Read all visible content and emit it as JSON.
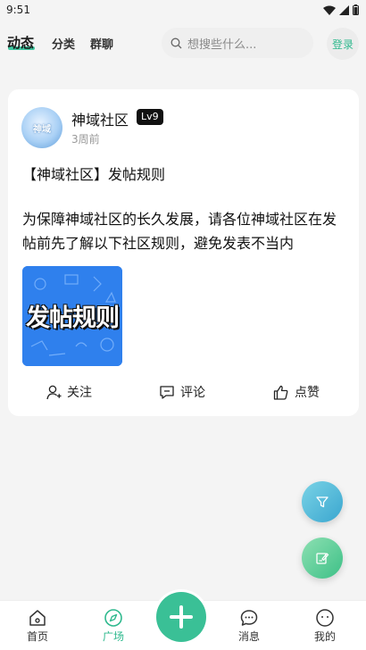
{
  "status_bar": {
    "time": "9:51"
  },
  "header": {
    "tabs": [
      {
        "label": "动态"
      },
      {
        "label": "分类"
      },
      {
        "label": "群聊"
      }
    ],
    "search_placeholder": "想搜些什么...",
    "login_label": "登录"
  },
  "post": {
    "author": "神域社区",
    "avatar_text": "神域",
    "level": "Lv9",
    "time": "3周前",
    "title": "【神域社区】发帖规则",
    "body": "为保障神域社区的长久发展，请各位神域社区在发帖前先了解以下社区规则，避免发表不当内",
    "image_text": "发帖规则",
    "actions": {
      "follow": "关注",
      "comment": "评论",
      "like": "点赞"
    }
  },
  "bottom_nav": {
    "items": [
      {
        "label": "首页"
      },
      {
        "label": "广场"
      },
      {
        "label": "消息"
      },
      {
        "label": "我的"
      }
    ]
  },
  "colors": {
    "accent": "#40c9a2",
    "brand": "#2fb98e"
  }
}
